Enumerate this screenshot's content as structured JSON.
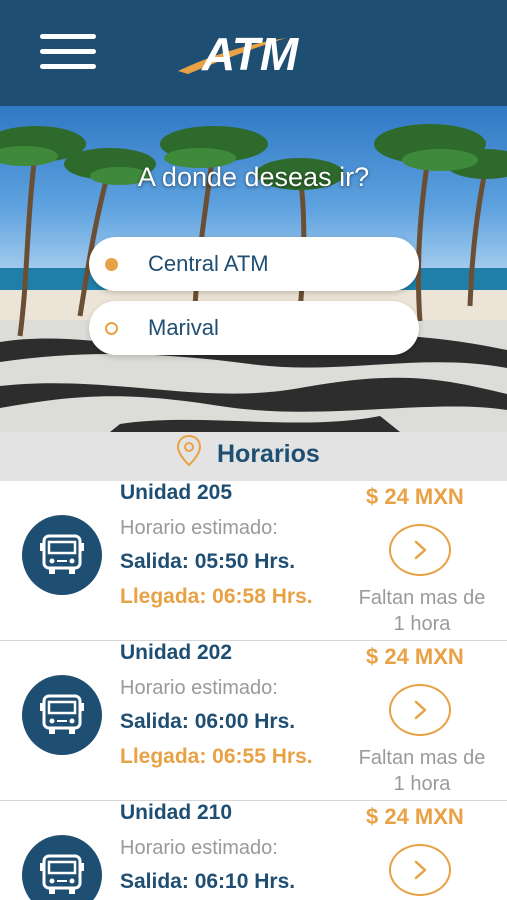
{
  "app": {
    "name": "ATM",
    "colors": {
      "primary": "#1f4e73",
      "accent": "#e8a245",
      "muted": "#9a9a9a"
    }
  },
  "header": {
    "menu_icon": "hamburger-menu-icon",
    "logo_text": "ATM"
  },
  "hero": {
    "title": "A donde deseas ir?",
    "origin": "Central ATM",
    "destination": "Marival"
  },
  "section": {
    "title": "Horarios",
    "icon": "location-pin-icon"
  },
  "schedules": [
    {
      "unit": "Unidad 205",
      "price": "$ 24 MXN",
      "estimated_label": "Horario estimado:",
      "departure": "Salida: 05:50 Hrs.",
      "arrival": "Llegada: 06:58 Hrs.",
      "remaining_line1": "Faltan mas de",
      "remaining_line2": "1 hora"
    },
    {
      "unit": "Unidad 202",
      "price": "$ 24 MXN",
      "estimated_label": "Horario estimado:",
      "departure": "Salida: 06:00 Hrs.",
      "arrival": "Llegada: 06:55 Hrs.",
      "remaining_line1": "Faltan mas de",
      "remaining_line2": "1 hora"
    },
    {
      "unit": "Unidad 210",
      "price": "$ 24 MXN",
      "estimated_label": "Horario estimado:",
      "departure": "Salida: 06:10 Hrs.",
      "arrival": "",
      "remaining_line1": "",
      "remaining_line2": ""
    }
  ]
}
